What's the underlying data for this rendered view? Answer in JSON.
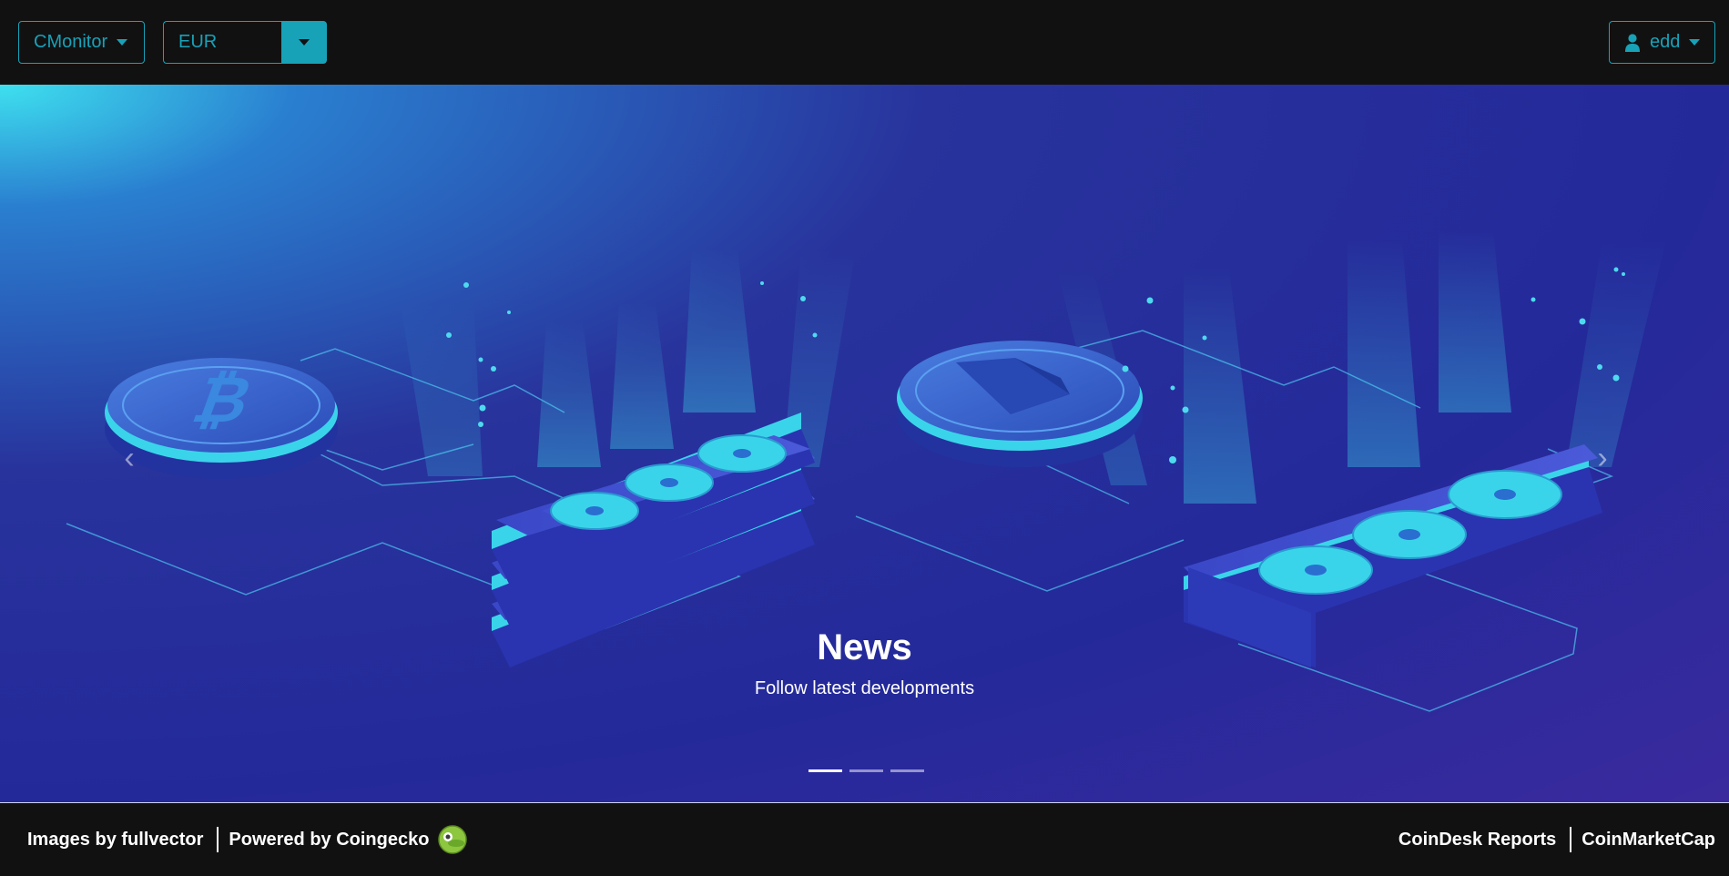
{
  "navbar": {
    "brand_label": "CMonitor",
    "currency": {
      "selected": "EUR"
    },
    "user": {
      "label": "edd",
      "icon": "user-icon"
    }
  },
  "carousel": {
    "slide": {
      "title": "News",
      "subtitle": "Follow latest developments"
    },
    "indicators": 3,
    "active_index": 0,
    "prev_icon": "chevron-left-icon",
    "next_icon": "chevron-right-icon"
  },
  "footer": {
    "left": {
      "images_credit": "Images by fullvector",
      "powered_by": "Powered by Coingecko",
      "logo_icon": "coingecko-logo"
    },
    "right": {
      "link_1": "CoinDesk Reports",
      "link_2": "CoinMarketCap"
    }
  },
  "colors": {
    "accent": "#17a2b8",
    "nav_bg": "#121111",
    "hero_primary": "#24299a",
    "hero_glow": "#3ee0ef"
  }
}
